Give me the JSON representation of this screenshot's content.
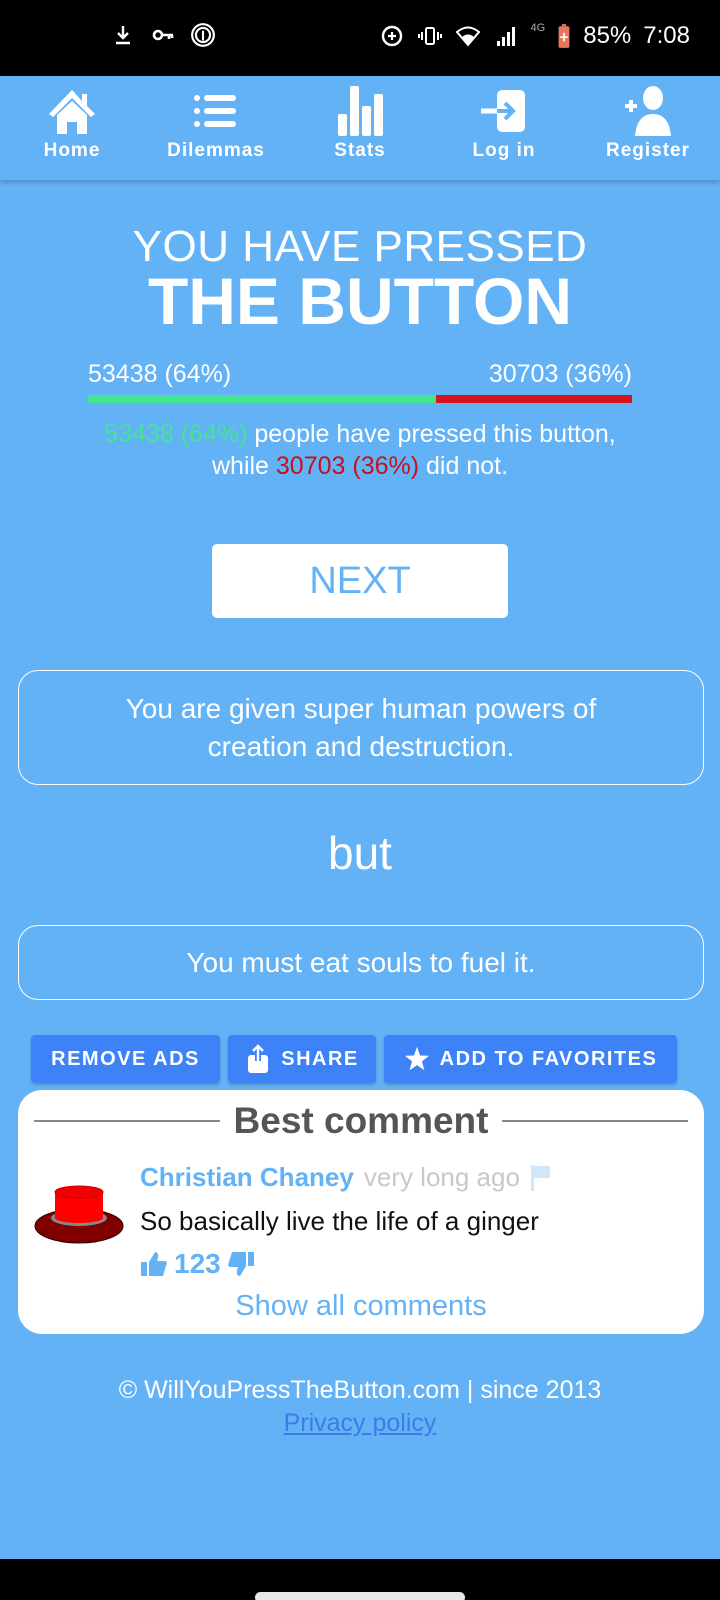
{
  "status_bar": {
    "left_icons": [
      "download-icon",
      "key-icon",
      "fingerprint-icon"
    ],
    "right_icons": [
      "data-saver-icon",
      "vibrate-icon",
      "wifi-icon",
      "signal-icon"
    ],
    "network": "4G",
    "battery": "85%",
    "time": "7:08"
  },
  "nav": {
    "items": [
      {
        "label": "Home",
        "icon": "home-icon"
      },
      {
        "label": "Dilemmas",
        "icon": "list-icon"
      },
      {
        "label": "Stats",
        "icon": "bar-chart-icon"
      },
      {
        "label": "Log in",
        "icon": "login-icon"
      },
      {
        "label": "Register",
        "icon": "add-user-icon"
      }
    ]
  },
  "result": {
    "subtitle": "YOU HAVE PRESSED",
    "title": "THE BUTTON",
    "pressed_label": "53438 (64%)",
    "not_pressed_label": "30703 (36%)",
    "pressed_fraction": 0.64,
    "not_pressed_fraction": 0.36,
    "summary_pressed": "53438 (64%)",
    "summary_mid": " people have pressed this button, while ",
    "summary_not_pressed": "30703 (36%)",
    "summary_end": " did not.",
    "colors": {
      "pressed": "#43e590",
      "not_pressed": "#d8141c"
    }
  },
  "next_label": "NEXT",
  "dilemma": {
    "benefit": "You are given super human powers of creation and destruction.",
    "connector": "but",
    "drawback": "You must eat souls to fuel it."
  },
  "actions": {
    "remove_ads": "REMOVE ADS",
    "share": "SHARE",
    "favorites": "ADD TO FAVORITES"
  },
  "best_comment": {
    "heading": "Best comment",
    "author": "Christian Chaney",
    "time": "very long ago",
    "text": "So basically live the life of a ginger",
    "votes": "123",
    "show_all": "Show all comments"
  },
  "footer": {
    "copyright": "© WillYouPressTheButton.com | since 2013",
    "privacy": "Privacy policy"
  }
}
